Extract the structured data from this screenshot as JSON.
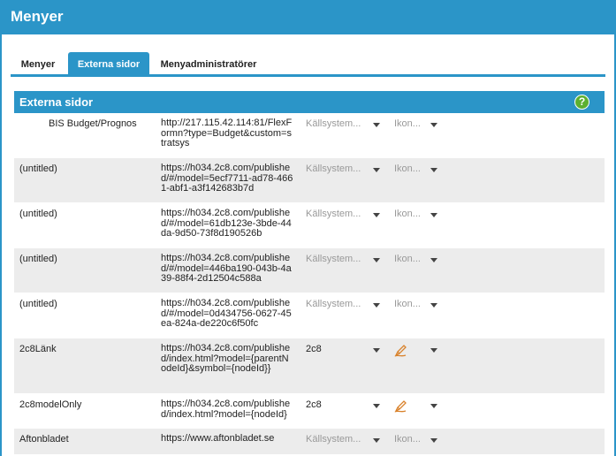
{
  "window": {
    "title": "Menyer"
  },
  "tabs": [
    {
      "label": "Menyer",
      "active": false
    },
    {
      "label": "Externa sidor",
      "active": true
    },
    {
      "label": "Menyadministratörer",
      "active": false
    }
  ],
  "section": {
    "title": "Externa sidor",
    "help_icon": "question-circle-icon",
    "help_glyph": "?"
  },
  "colors": {
    "accent": "#2b95c8",
    "row_alt": "#ececec",
    "help_green": "#5cb031",
    "pen_orange": "#d9822b"
  },
  "rows": [
    {
      "name": "BIS Budget/Prognos",
      "url": "http://217.115.42.114:81/FlexFormn?type=Budget&custom=stratsys",
      "source": "Källsystem...",
      "icon": "Ikon..."
    },
    {
      "name": "(untitled)",
      "url": "https://h034.2c8.com/published/#/model=5ecf7711-ad78-4661-abf1-a3f142683b7d",
      "source": "Källsystem...",
      "icon": "Ikon..."
    },
    {
      "name": "(untitled)",
      "url": "https://h034.2c8.com/published/#/model=61db123e-3bde-44da-9d50-73f8d190526b",
      "source": "Källsystem...",
      "icon": "Ikon..."
    },
    {
      "name": "(untitled)",
      "url": "https://h034.2c8.com/published/#/model=446ba190-043b-4a39-88f4-2d12504c588a",
      "source": "Källsystem...",
      "icon": "Ikon..."
    },
    {
      "name": "(untitled)",
      "url": "https://h034.2c8.com/published/#/model=0d434756-0627-45ea-824a-de220c6f50fc",
      "source": "Källsystem...",
      "icon": "Ikon..."
    },
    {
      "name": "2c8Länk",
      "url": "https://h034.2c8.com/published/index.html?model={parentNodeId}&symbol={nodeId}}",
      "source": "2c8",
      "icon": "pen-icon"
    },
    {
      "name": "2c8modelOnly",
      "url": "https://h034.2c8.com/published/index.html?model={nodeId}",
      "source": "2c8",
      "icon": "pen-icon"
    },
    {
      "name": "Aftonbladet",
      "url": "https://www.aftonbladet.se",
      "source": "Källsystem...",
      "icon": "Ikon..."
    }
  ]
}
